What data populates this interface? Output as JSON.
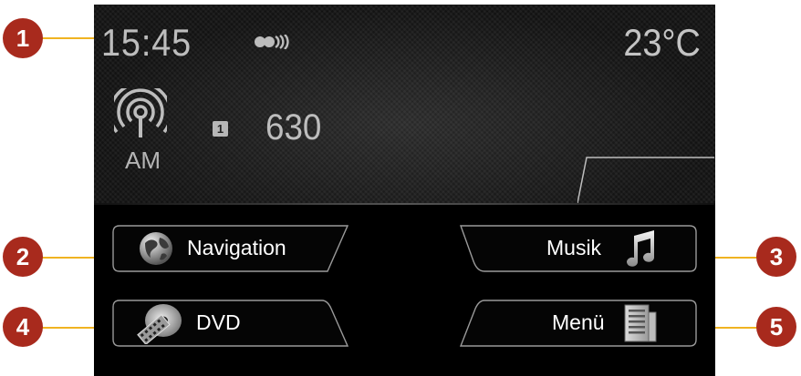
{
  "status": {
    "time": "15:45",
    "temperature": "23°C",
    "band": "AM",
    "preset": "1",
    "frequency": "630"
  },
  "buttons": {
    "navigation": "Navigation",
    "music": "Musik",
    "dvd": "DVD",
    "menu": "Menü"
  },
  "callouts": [
    "1",
    "2",
    "3",
    "4",
    "5"
  ],
  "colors": {
    "callout_badge": "#a82a1d",
    "callout_line": "#f0b321",
    "screen_bg": "#000000",
    "text": "#bdbdbd"
  },
  "icons": {
    "signal": "signal-dots-icon",
    "radio": "radio-antenna-icon",
    "navigation": "globe-icon",
    "music": "music-note-icon",
    "dvd": "dvd-film-icon",
    "menu": "menu-list-icon"
  }
}
